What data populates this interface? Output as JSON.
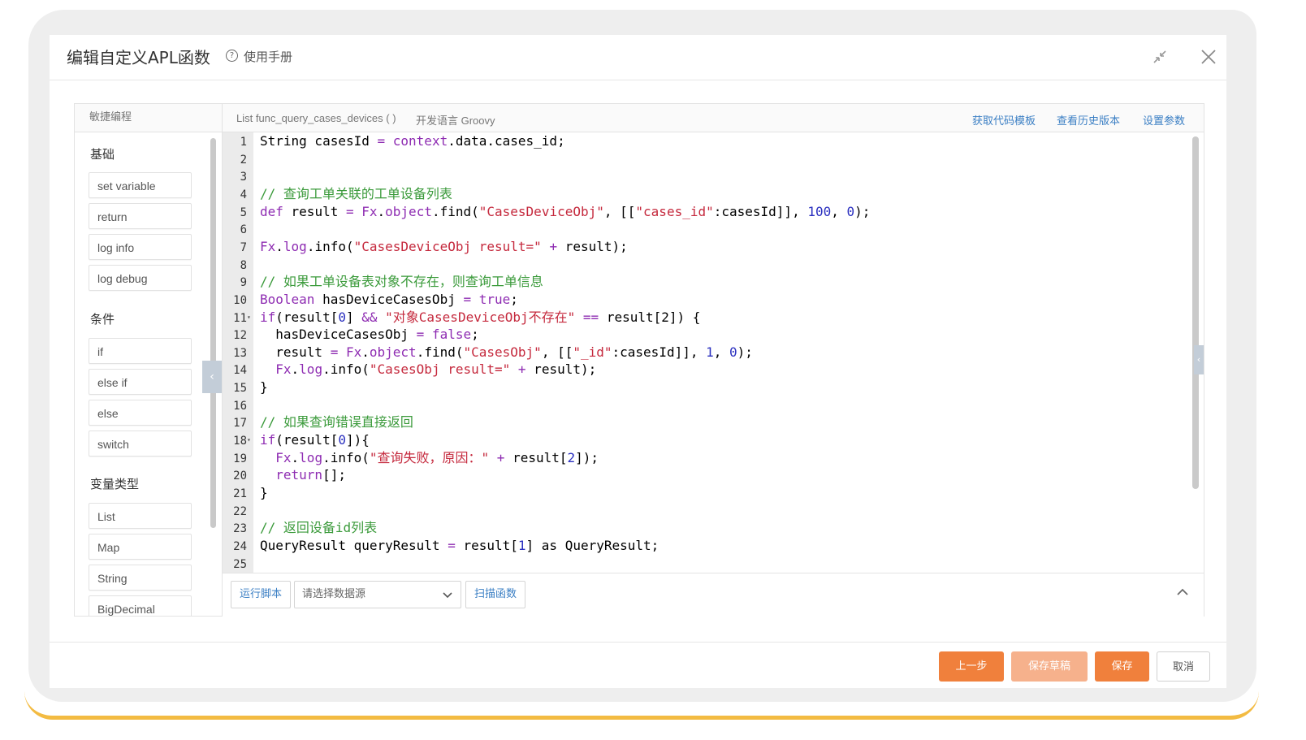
{
  "dialog": {
    "title": "编辑自定义APL函数",
    "help_label": "使用手册"
  },
  "left_panel": {
    "title": "敏捷编程",
    "groups": [
      {
        "title": "基础",
        "items": [
          "set variable",
          "return",
          "log info",
          "log debug"
        ]
      },
      {
        "title": "条件",
        "items": [
          "if",
          "else if",
          "else",
          "switch"
        ]
      },
      {
        "title": "变量类型",
        "items": [
          "List",
          "Map",
          "String",
          "BigDecimal"
        ]
      }
    ]
  },
  "editor_header": {
    "signature": "List func_query_cases_devices ( )",
    "language": "开发语言 Groovy",
    "links": [
      "获取代码模板",
      "查看历史版本",
      "设置参数"
    ]
  },
  "code": {
    "lines": [
      [
        [
          "",
          "String casesId "
        ],
        [
          "op",
          "="
        ],
        [
          "kw",
          " context"
        ],
        [
          "",
          ".data.cases_id;"
        ]
      ],
      [],
      [],
      [
        [
          "cmt",
          "// 查询工单关联的工单设备列表"
        ]
      ],
      [
        [
          "kw",
          "def"
        ],
        [
          "",
          " result "
        ],
        [
          "op",
          "="
        ],
        [
          "kw",
          " Fx"
        ],
        [
          "",
          "."
        ],
        [
          "kw",
          "object"
        ],
        [
          "",
          ".find("
        ],
        [
          "str",
          "\"CasesDeviceObj\""
        ],
        [
          "",
          ", [["
        ],
        [
          "str",
          "\"cases_id\""
        ],
        [
          "",
          ":casesId]], "
        ],
        [
          "num",
          "100"
        ],
        [
          "",
          ", "
        ],
        [
          "num",
          "0"
        ],
        [
          "",
          ");"
        ]
      ],
      [],
      [
        [
          "kw",
          "Fx"
        ],
        [
          "",
          "."
        ],
        [
          "kw",
          "log"
        ],
        [
          "",
          ".info("
        ],
        [
          "str",
          "\"CasesDeviceObj result=\""
        ],
        [
          "",
          " "
        ],
        [
          "op",
          "+"
        ],
        [
          "",
          " result);"
        ]
      ],
      [],
      [
        [
          "cmt",
          "// 如果工单设备表对象不存在，则查询工单信息"
        ]
      ],
      [
        [
          "kw",
          "Boolean"
        ],
        [
          "",
          " hasDeviceCasesObj "
        ],
        [
          "op",
          "="
        ],
        [
          "kw",
          " true"
        ],
        [
          "",
          ";"
        ]
      ],
      [
        [
          "kw",
          "if"
        ],
        [
          "",
          "(result["
        ],
        [
          "num",
          "0"
        ],
        [
          "",
          "] "
        ],
        [
          "op",
          "&&"
        ],
        [
          "",
          " "
        ],
        [
          "str",
          "\"对象CasesDeviceObj不存在\""
        ],
        [
          "",
          " "
        ],
        [
          "op",
          "=="
        ],
        [
          "",
          " result[2]) {"
        ]
      ],
      [
        [
          "",
          "  hasDeviceCasesObj "
        ],
        [
          "op",
          "="
        ],
        [
          "kw",
          " false"
        ],
        [
          "",
          ";"
        ]
      ],
      [
        [
          "",
          "  result "
        ],
        [
          "op",
          "="
        ],
        [
          "kw",
          " Fx"
        ],
        [
          "",
          "."
        ],
        [
          "kw",
          "object"
        ],
        [
          "",
          ".find("
        ],
        [
          "str",
          "\"CasesObj\""
        ],
        [
          "",
          ", [["
        ],
        [
          "str",
          "\"_id\""
        ],
        [
          "",
          ":casesId]], "
        ],
        [
          "num",
          "1"
        ],
        [
          "",
          ", "
        ],
        [
          "num",
          "0"
        ],
        [
          "",
          ");"
        ]
      ],
      [
        [
          "kw",
          "  Fx"
        ],
        [
          "",
          "."
        ],
        [
          "kw",
          "log"
        ],
        [
          "",
          ".info("
        ],
        [
          "str",
          "\"CasesObj result=\""
        ],
        [
          "",
          " "
        ],
        [
          "op",
          "+"
        ],
        [
          "",
          " result);"
        ]
      ],
      [
        [
          "",
          "}"
        ]
      ],
      [],
      [
        [
          "cmt",
          "// 如果查询错误直接返回"
        ]
      ],
      [
        [
          "kw",
          "if"
        ],
        [
          "",
          "(result["
        ],
        [
          "num",
          "0"
        ],
        [
          "",
          "]){"
        ]
      ],
      [
        [
          "kw",
          "  Fx"
        ],
        [
          "",
          "."
        ],
        [
          "kw",
          "log"
        ],
        [
          "",
          ".info("
        ],
        [
          "str",
          "\"查询失败，原因：\""
        ],
        [
          "",
          " "
        ],
        [
          "op",
          "+"
        ],
        [
          "",
          " result["
        ],
        [
          "num",
          "2"
        ],
        [
          "",
          "]);"
        ]
      ],
      [
        [
          "kw",
          "  return"
        ],
        [
          "",
          "[];"
        ]
      ],
      [
        [
          "",
          "}"
        ]
      ],
      [],
      [
        [
          "cmt",
          "// 返回设备id列表"
        ]
      ],
      [
        [
          "",
          "QueryResult queryResult "
        ],
        [
          "op",
          "="
        ],
        [
          "",
          " result["
        ],
        [
          "num",
          "1"
        ],
        [
          "",
          "] as QueryResult;"
        ]
      ],
      []
    ],
    "fold_lines": [
      11,
      18
    ]
  },
  "run_bar": {
    "run_label": "运行脚本",
    "datasource_placeholder": "请选择数据源",
    "scan_label": "扫描函数"
  },
  "footer": {
    "prev_label": "上一步",
    "draft_label": "保存草稿",
    "save_label": "保存",
    "cancel_label": "取消"
  },
  "colors": {
    "accent": "#f0803c",
    "accent_light": "#f6b18c",
    "link": "#3b7fc4",
    "keyword": "#8e2cb2",
    "string": "#c5293d",
    "number": "#2a2fbf",
    "comment": "#3a9a3a"
  }
}
